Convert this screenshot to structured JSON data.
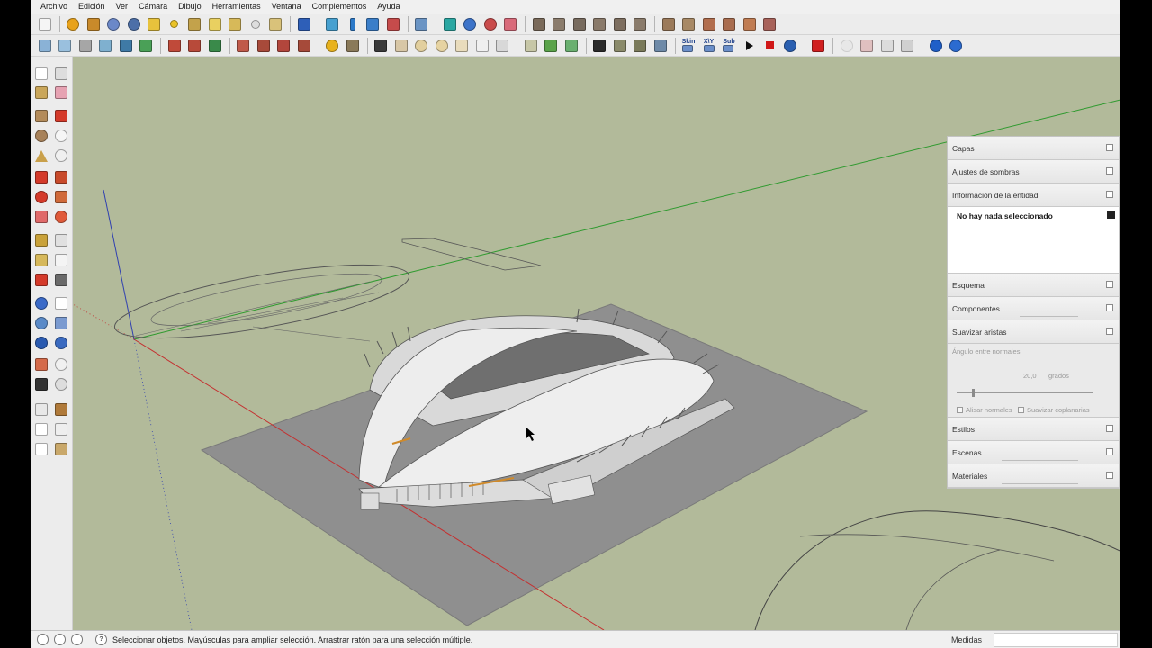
{
  "menu": {
    "items": [
      "Archivo",
      "Edición",
      "Ver",
      "Cámara",
      "Dibujo",
      "Herramientas",
      "Ventana",
      "Complementos",
      "Ayuda"
    ]
  },
  "toolbar2_text": {
    "skin": "Skin",
    "xyz": "X\\Y",
    "sub": "Sub"
  },
  "tray": {
    "panels": {
      "capas": "Capas",
      "sombras": "Ajustes de sombras",
      "entidad": "Información de la entidad",
      "esquema": "Esquema",
      "componentes": "Componentes",
      "suavizar": "Suavizar aristas",
      "estilos": "Estilos",
      "escenas": "Escenas",
      "materiales": "Materiales"
    },
    "entity_info": "No hay nada seleccionado",
    "soften": {
      "angle_label": "Ángulo entre normales:",
      "angle_value": "20,0",
      "angle_units": "grados",
      "smooth_normals": "Alisar normales",
      "soften_coplanar": "Suavizar coplanarias"
    }
  },
  "status": {
    "text": "Seleccionar objetos. Mayúsculas para ampliar selección. Arrastrar ratón para una selección múltiple.",
    "measure_label": "Medidas",
    "measure_value": ""
  },
  "colors": {
    "viewport_bg": "#b2ba9a",
    "ground": "#8f8f8f",
    "axis_red": "#c43030",
    "axis_green": "#2f9a2f",
    "axis_blue": "#3040b0",
    "stadium_roof": "#eeeeee"
  }
}
